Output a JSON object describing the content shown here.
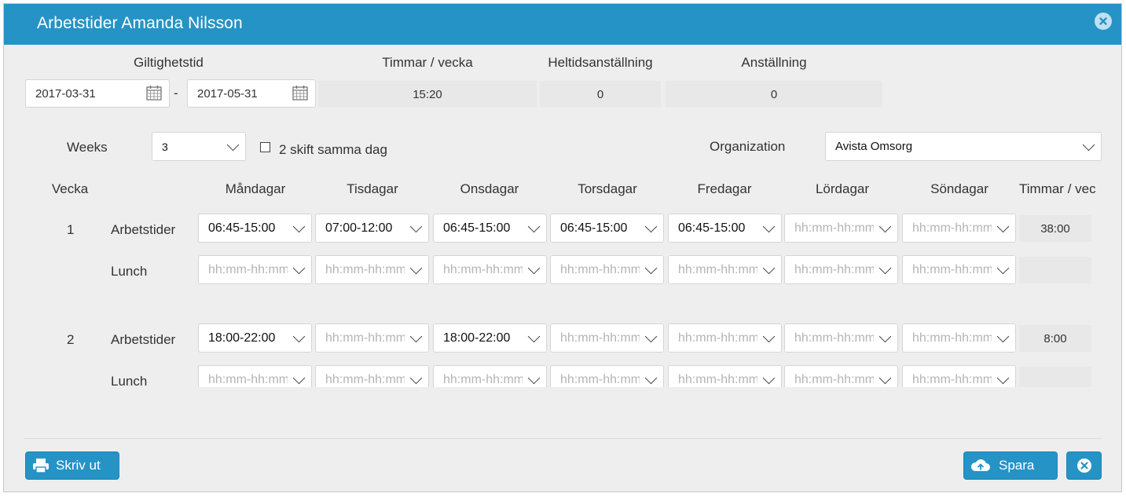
{
  "dialog": {
    "title": "Arbetstider Amanda Nilsson"
  },
  "validity": {
    "label": "Giltighetstid",
    "from": "2017-03-31",
    "to": "2017-05-31",
    "separator": "-"
  },
  "stats": {
    "hours_per_week_label": "Timmar / vecka",
    "hours_per_week_value": "15:20",
    "fulltime_label": "Heltidsanställning",
    "fulltime_value": "0",
    "employment_label": "Anställning",
    "employment_value": "0"
  },
  "weeks": {
    "label": "Weeks",
    "value": "3"
  },
  "two_shift": {
    "label": "2 skift samma dag",
    "checked": false
  },
  "organization": {
    "label": "Organization",
    "value": "Avista Omsorg"
  },
  "schedule": {
    "headers": [
      "Vecka",
      "Måndagar",
      "Tisdagar",
      "Onsdagar",
      "Torsdagar",
      "Fredagar",
      "Lördagar",
      "Söndagar",
      "Timmar / vec"
    ],
    "placeholder": "hh:mm-hh:mm",
    "rows": [
      {
        "week": "1",
        "label": "Arbetstider",
        "days": [
          "06:45-15:00",
          "07:00-12:00",
          "06:45-15:00",
          "06:45-15:00",
          "06:45-15:00",
          "",
          ""
        ],
        "total": "38:00"
      },
      {
        "week": "",
        "label": "Lunch",
        "days": [
          "",
          "",
          "",
          "",
          "",
          "",
          ""
        ],
        "total": ""
      },
      {
        "week": "2",
        "label": "Arbetstider",
        "days": [
          "18:00-22:00",
          "",
          "18:00-22:00",
          "",
          "",
          "",
          ""
        ],
        "total": "8:00"
      },
      {
        "week": "",
        "label": "Lunch",
        "days": [
          "",
          "",
          "",
          "",
          "",
          "",
          ""
        ],
        "total": ""
      }
    ]
  },
  "buttons": {
    "print": "Skriv ut",
    "save": "Spara"
  },
  "colors": {
    "header_bg": "#2593c5",
    "button_bg": "#2593c5",
    "dialog_bg": "#eeeeee"
  },
  "icons": {
    "close": "close-circle-icon",
    "calendar": "calendar-icon",
    "print": "printer-icon",
    "save": "cloud-upload-icon",
    "dropdown": "chevron-down-icon"
  }
}
